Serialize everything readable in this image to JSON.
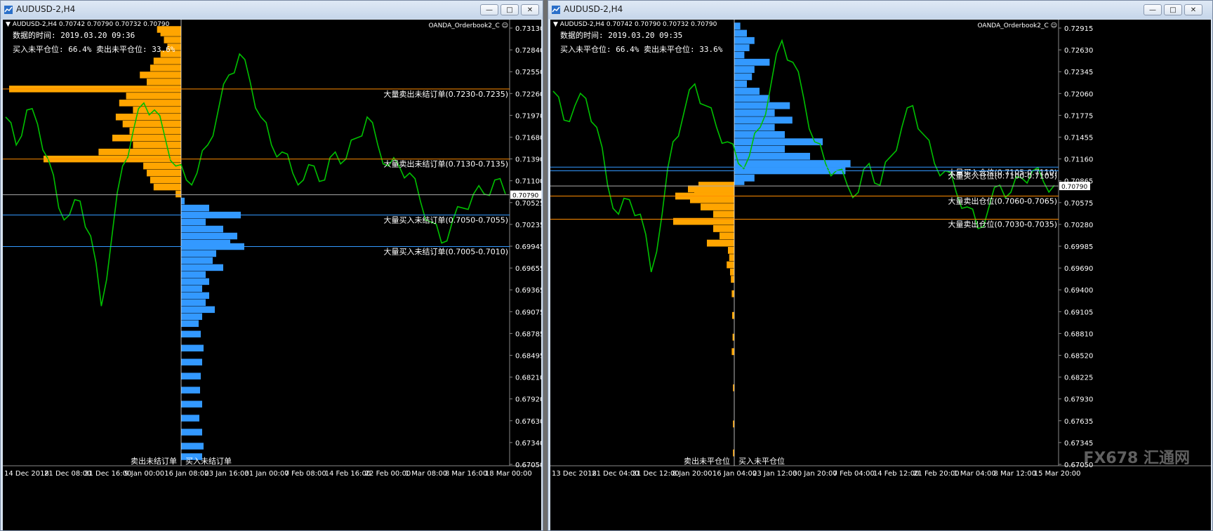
{
  "windows": [
    {
      "title": "AUDUSD-2,H4",
      "symbol_info": "AUDUSD-2,H4  0.70742 0.70790 0.70732 0.70790",
      "indicator_name": "OANDA_Orderbook2_C",
      "data_time": "数据的时间: 2019.03.20 09:36",
      "ratio": "买入未平仓位: 66.4%  卖出未平仓位: 33.6%",
      "current_price": "0.70790",
      "price_labels": [
        "0.73130",
        "0.72840",
        "0.72550",
        "0.72260",
        "0.71970",
        "0.71680",
        "0.71390",
        "0.71100",
        "0.70525",
        "0.70235",
        "0.69945",
        "0.69655",
        "0.69365",
        "0.69075",
        "0.68785",
        "0.68495",
        "0.68210",
        "0.67920",
        "0.67630",
        "0.67340",
        "0.67050"
      ],
      "date_labels": [
        "14 Dec 2018",
        "21 Dec 08:00",
        "31 Dec 16:00",
        "9 Jan 00:00",
        "16 Jan 08:00",
        "23 Jan 16:00",
        "31 Jan 00:00",
        "7 Feb 08:00",
        "14 Feb 16:00",
        "22 Feb 00:00",
        "1 Mar 08:00",
        "8 Mar 16:00",
        "18 Mar 00:00"
      ],
      "level_labels": [
        {
          "text": "大量卖出未结订单(0.7230-0.7235)",
          "price": 0.723,
          "color": "#ff8c00"
        },
        {
          "text": "大量卖出未结订单(0.7130-0.7135)",
          "price": 0.713,
          "color": "#ff8c00"
        },
        {
          "text": "大量买入未结订单(0.7050-0.7055)",
          "price": 0.705,
          "color": "#3399ff"
        },
        {
          "text": "大量买入未结订单(0.7005-0.7010)",
          "price": 0.7005,
          "color": "#3399ff"
        }
      ],
      "sell_label": "卖出未结订单",
      "buy_label": "买入未结订单"
    },
    {
      "title": "AUDUSD-2,H4",
      "symbol_info": "AUDUSD-2,H4  0.70742 0.70790 0.70732 0.70790",
      "indicator_name": "OANDA_Orderbook2_C",
      "data_time": "数据的时间: 2019.03.20 09:35",
      "ratio": "买入未平仓位: 66.4%  卖出未平仓位: 33.6%",
      "current_price": "0.70790",
      "price_labels": [
        "0.72915",
        "0.72630",
        "0.72345",
        "0.72060",
        "0.71775",
        "0.71455",
        "0.71160",
        "0.70865",
        "0.70575",
        "0.70280",
        "0.69985",
        "0.69690",
        "0.69400",
        "0.69105",
        "0.68810",
        "0.68520",
        "0.68225",
        "0.67930",
        "0.67635",
        "0.67345",
        "0.67050"
      ],
      "date_labels": [
        "13 Dec 2018",
        "21 Dec 04:00",
        "31 Dec 12:00",
        "8 Jan 20:00",
        "16 Jan 04:00",
        "23 Jan 12:00",
        "30 Jan 20:00",
        "7 Feb 04:00",
        "14 Feb 12:00",
        "21 Feb 20:00",
        "1 Mar 04:00",
        "8 Mar 12:00",
        "15 Mar 20:00"
      ],
      "level_labels": [
        {
          "text": "大量买入仓位(0.7105-0.7110)",
          "price": 0.7105,
          "color": "#3399ff"
        },
        {
          "text": "大量买入仓位(0.7100-0.7105)",
          "price": 0.71,
          "color": "#3399ff"
        },
        {
          "text": "大量卖出仓位(0.7060-0.7065)",
          "price": 0.7065,
          "color": "#ff8c00"
        },
        {
          "text": "大量卖出仓位(0.7030-0.7035)",
          "price": 0.7033,
          "color": "#ff8c00"
        }
      ],
      "sell_label": "卖出未平仓位",
      "buy_label": "买入未平仓位",
      "watermark": "FX678 汇通网"
    }
  ],
  "colors": {
    "background": "#000000",
    "candle": "#00c000",
    "sell": "#ffa500",
    "buy": "#3399ff",
    "text": "#ffffff",
    "price_box": "#ffffff"
  },
  "chart_data": [
    {
      "type": "line",
      "title": "AUDUSD-2,H4",
      "ylim": [
        0.67,
        0.7325
      ],
      "current": 0.7079,
      "x": [
        "14 Dec 2018",
        "21 Dec 08:00",
        "31 Dec 16:00",
        "9 Jan 00:00",
        "16 Jan 08:00",
        "23 Jan 16:00",
        "31 Jan 00:00",
        "7 Feb 08:00",
        "14 Feb 16:00",
        "22 Feb 00:00",
        "1 Mar 08:00",
        "8 Mar 16:00",
        "18 Mar 00:00"
      ],
      "series": [
        {
          "values": [
            0.719,
            0.715,
            0.72,
            0.718,
            0.713,
            0.706,
            0.705,
            0.707,
            0.702,
            0.692,
            0.702,
            0.712,
            0.717,
            0.721,
            0.72,
            0.716,
            0.712,
            0.71,
            0.711,
            0.715,
            0.72,
            0.725,
            0.728,
            0.724,
            0.719,
            0.715,
            0.714,
            0.711,
            0.71,
            0.712,
            0.71,
            0.714,
            0.713,
            0.716,
            0.719,
            0.715,
            0.712,
            0.712,
            0.711,
            0.707,
            0.704,
            0.701,
            0.704,
            0.706,
            0.708,
            0.708,
            0.71,
            0.708
          ]
        }
      ],
      "sell_levels": [
        {
          "price": 0.7315,
          "value": 35
        },
        {
          "price": 0.731,
          "value": 30
        },
        {
          "price": 0.73,
          "value": 25
        },
        {
          "price": 0.729,
          "value": 20
        },
        {
          "price": 0.728,
          "value": 30
        },
        {
          "price": 0.727,
          "value": 40
        },
        {
          "price": 0.726,
          "value": 45
        },
        {
          "price": 0.725,
          "value": 60
        },
        {
          "price": 0.724,
          "value": 50
        },
        {
          "price": 0.723,
          "value": 250
        },
        {
          "price": 0.722,
          "value": 80
        },
        {
          "price": 0.721,
          "value": 90
        },
        {
          "price": 0.72,
          "value": 70
        },
        {
          "price": 0.719,
          "value": 95
        },
        {
          "price": 0.718,
          "value": 85
        },
        {
          "price": 0.717,
          "value": 75
        },
        {
          "price": 0.716,
          "value": 100
        },
        {
          "price": 0.715,
          "value": 70
        },
        {
          "price": 0.714,
          "value": 120
        },
        {
          "price": 0.713,
          "value": 200
        },
        {
          "price": 0.712,
          "value": 55
        },
        {
          "price": 0.711,
          "value": 50
        },
        {
          "price": 0.71,
          "value": 45
        },
        {
          "price": 0.709,
          "value": 40
        },
        {
          "price": 0.708,
          "value": 8
        }
      ],
      "buy_levels": [
        {
          "price": 0.707,
          "value": 5
        },
        {
          "price": 0.706,
          "value": 40
        },
        {
          "price": 0.705,
          "value": 85
        },
        {
          "price": 0.704,
          "value": 35
        },
        {
          "price": 0.703,
          "value": 60
        },
        {
          "price": 0.702,
          "value": 80
        },
        {
          "price": 0.701,
          "value": 70
        },
        {
          "price": 0.7005,
          "value": 90
        },
        {
          "price": 0.6995,
          "value": 50
        },
        {
          "price": 0.6985,
          "value": 45
        },
        {
          "price": 0.6975,
          "value": 60
        },
        {
          "price": 0.6965,
          "value": 35
        },
        {
          "price": 0.6955,
          "value": 40
        },
        {
          "price": 0.6945,
          "value": 30
        },
        {
          "price": 0.6935,
          "value": 40
        },
        {
          "price": 0.6925,
          "value": 35
        },
        {
          "price": 0.6915,
          "value": 48
        },
        {
          "price": 0.6905,
          "value": 30
        },
        {
          "price": 0.6895,
          "value": 25
        },
        {
          "price": 0.688,
          "value": 28
        },
        {
          "price": 0.686,
          "value": 32
        },
        {
          "price": 0.684,
          "value": 30
        },
        {
          "price": 0.682,
          "value": 28
        },
        {
          "price": 0.68,
          "value": 27
        },
        {
          "price": 0.678,
          "value": 30
        },
        {
          "price": 0.676,
          "value": 26
        },
        {
          "price": 0.674,
          "value": 30
        },
        {
          "price": 0.672,
          "value": 32
        },
        {
          "price": 0.6705,
          "value": 30
        }
      ]
    },
    {
      "type": "line",
      "title": "AUDUSD-2,H4",
      "ylim": [
        0.67,
        0.7305
      ],
      "current": 0.7079,
      "x": [
        "13 Dec 2018",
        "21 Dec 04:00",
        "31 Dec 12:00",
        "8 Jan 20:00",
        "16 Jan 04:00",
        "23 Jan 12:00",
        "30 Jan 20:00",
        "7 Feb 04:00",
        "14 Feb 12:00",
        "21 Feb 20:00",
        "1 Mar 04:00",
        "8 Mar 12:00",
        "15 Mar 20:00"
      ],
      "series": [
        {
          "values": [
            0.721,
            0.717,
            0.719,
            0.72,
            0.716,
            0.708,
            0.704,
            0.706,
            0.704,
            0.696,
            0.704,
            0.714,
            0.718,
            0.722,
            0.719,
            0.716,
            0.714,
            0.711,
            0.712,
            0.716,
            0.722,
            0.728,
            0.725,
            0.72,
            0.714,
            0.711,
            0.71,
            0.708,
            0.707,
            0.711,
            0.708,
            0.712,
            0.716,
            0.719,
            0.715,
            0.711,
            0.71,
            0.707,
            0.705,
            0.702,
            0.705,
            0.708,
            0.707,
            0.709,
            0.71,
            0.7085,
            0.708
          ]
        }
      ],
      "buy_levels": [
        {
          "price": 0.73,
          "value": 12
        },
        {
          "price": 0.729,
          "value": 25
        },
        {
          "price": 0.728,
          "value": 40
        },
        {
          "price": 0.727,
          "value": 30
        },
        {
          "price": 0.726,
          "value": 20
        },
        {
          "price": 0.725,
          "value": 70
        },
        {
          "price": 0.724,
          "value": 40
        },
        {
          "price": 0.723,
          "value": 35
        },
        {
          "price": 0.722,
          "value": 25
        },
        {
          "price": 0.721,
          "value": 50
        },
        {
          "price": 0.72,
          "value": 70
        },
        {
          "price": 0.719,
          "value": 110
        },
        {
          "price": 0.718,
          "value": 80
        },
        {
          "price": 0.717,
          "value": 115
        },
        {
          "price": 0.716,
          "value": 80
        },
        {
          "price": 0.715,
          "value": 100
        },
        {
          "price": 0.714,
          "value": 175
        },
        {
          "price": 0.713,
          "value": 100
        },
        {
          "price": 0.712,
          "value": 150
        },
        {
          "price": 0.711,
          "value": 230
        },
        {
          "price": 0.71,
          "value": 220
        },
        {
          "price": 0.709,
          "value": 40
        },
        {
          "price": 0.7085,
          "value": 20
        }
      ],
      "sell_levels": [
        {
          "price": 0.708,
          "value": 85
        },
        {
          "price": 0.7075,
          "value": 110
        },
        {
          "price": 0.707,
          "value": 95
        },
        {
          "price": 0.7065,
          "value": 140
        },
        {
          "price": 0.706,
          "value": 105
        },
        {
          "price": 0.705,
          "value": 80
        },
        {
          "price": 0.704,
          "value": 50
        },
        {
          "price": 0.703,
          "value": 145
        },
        {
          "price": 0.702,
          "value": 50
        },
        {
          "price": 0.701,
          "value": 35
        },
        {
          "price": 0.7,
          "value": 65
        },
        {
          "price": 0.699,
          "value": 15
        },
        {
          "price": 0.698,
          "value": 12
        },
        {
          "price": 0.697,
          "value": 18
        },
        {
          "price": 0.696,
          "value": 10
        },
        {
          "price": 0.695,
          "value": 8
        },
        {
          "price": 0.693,
          "value": 6
        },
        {
          "price": 0.69,
          "value": 5
        },
        {
          "price": 0.687,
          "value": 4
        },
        {
          "price": 0.685,
          "value": 6
        },
        {
          "price": 0.68,
          "value": 3
        },
        {
          "price": 0.675,
          "value": 3
        },
        {
          "price": 0.671,
          "value": 3
        }
      ]
    }
  ]
}
